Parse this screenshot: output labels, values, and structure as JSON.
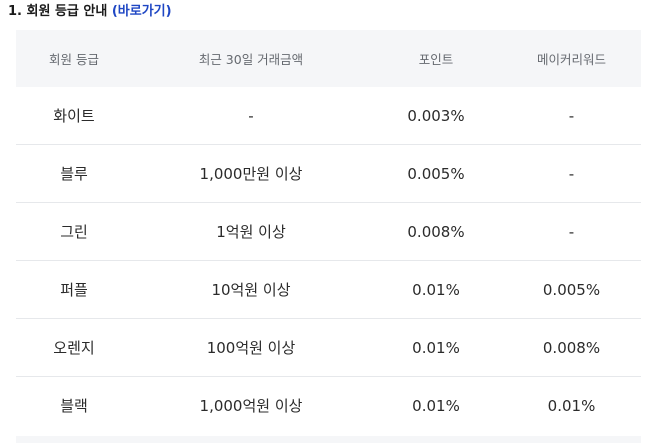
{
  "section": {
    "title": "1. 회원 등급 안내",
    "link_label": "(바로가기)"
  },
  "table": {
    "headers": [
      "회원 등급",
      "최근 30일 거래금액",
      "포인트",
      "메이커리워드"
    ],
    "rows": [
      [
        "화이트",
        "-",
        "0.003%",
        "-"
      ],
      [
        "블루",
        "1,000만원 이상",
        "0.005%",
        "-"
      ],
      [
        "그린",
        "1억원 이상",
        "0.008%",
        "-"
      ],
      [
        "퍼플",
        "10억원 이상",
        "0.01%",
        "0.005%"
      ],
      [
        "오렌지",
        "100억원 이상",
        "0.01%",
        "0.008%"
      ],
      [
        "블랙",
        "1,000억원 이상",
        "0.01%",
        "0.01%"
      ]
    ]
  },
  "colors": {
    "link": "#1f47c4",
    "header_bg": "#f5f6f8",
    "row_divider": "#e6e8eb"
  }
}
